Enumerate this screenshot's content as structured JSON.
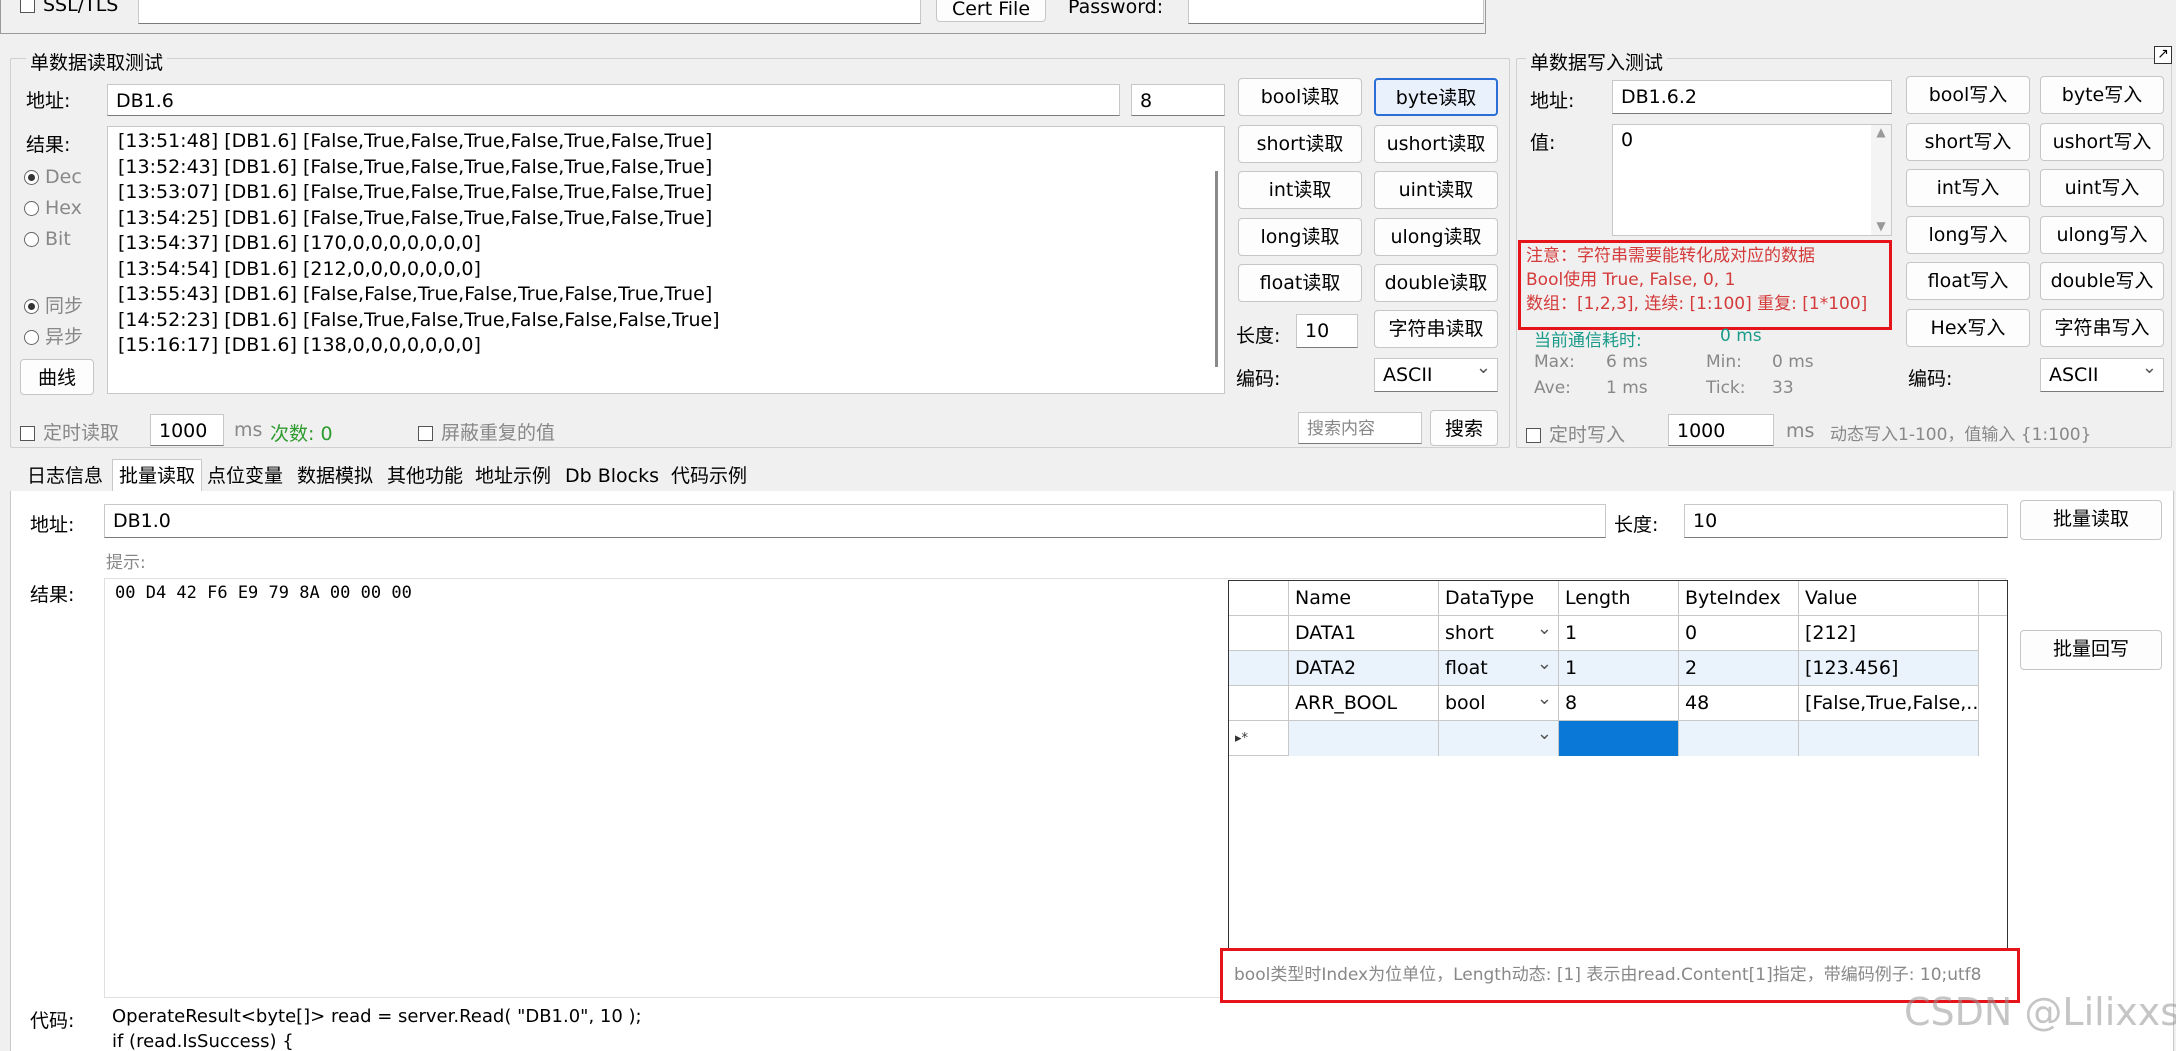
{
  "top": {
    "ssl_label": "SSL/TLS",
    "cert_button": "Cert File",
    "password_label": "Password:"
  },
  "read_panel": {
    "title": "单数据读取测试",
    "address_label": "地址:",
    "address_value": "DB1.6",
    "length_value": "8",
    "result_label": "结果:",
    "radios": {
      "dec": "Dec",
      "hex": "Hex",
      "bit": "Bit",
      "sync": "同步",
      "async": "异步"
    },
    "curve_button": "曲线",
    "log": [
      "[13:51:48] [DB1.6] [False,True,False,True,False,True,False,True]",
      "[13:52:43] [DB1.6] [False,True,False,True,False,True,False,True]",
      "[13:53:07] [DB1.6] [False,True,False,True,False,True,False,True]",
      "[13:54:25] [DB1.6] [False,True,False,True,False,True,False,True]",
      "[13:54:37] [DB1.6] [170,0,0,0,0,0,0,0]",
      "[13:54:54] [DB1.6] [212,0,0,0,0,0,0,0]",
      "[13:55:43] [DB1.6] [False,False,True,False,True,False,True,True]",
      "[14:52:23] [DB1.6] [False,True,False,True,False,False,False,True]",
      "[15:16:17] [DB1.6] [138,0,0,0,0,0,0,0]"
    ],
    "buttons": [
      "bool读取",
      "byte读取",
      "short读取",
      "ushort读取",
      "int读取",
      "uint读取",
      "long读取",
      "ulong读取",
      "float读取",
      "double读取"
    ],
    "length_label": "长度:",
    "length_field": "10",
    "string_read_button": "字符串读取",
    "encoding_label": "编码:",
    "encoding_value": "ASCII",
    "timer_label": "定时读取",
    "timer_value": "1000",
    "ms": "ms",
    "count_label": "次数: 0",
    "hide_dup_label": "屏蔽重复的值",
    "search_placeholder": "搜索内容",
    "search_button": "搜索"
  },
  "write_panel": {
    "title": "单数据写入测试",
    "address_label": "地址:",
    "address_value": "DB1.6.2",
    "value_label": "值:",
    "value_value": "0",
    "note_lines": [
      "注意：字符串需要能转化成对应的数据",
      "Bool使用 True, False, 0, 1",
      "数组：[1,2,3], 连续: [1:100] 重复: [1*100]"
    ],
    "stats_title": "当前通信耗时:",
    "stats_now": "0 ms",
    "max_label": "Max:",
    "max_value": "6 ms",
    "min_label": "Min:",
    "min_value": "0 ms",
    "ave_label": "Ave:",
    "ave_value": "1 ms",
    "tick_label": "Tick:",
    "tick_value": "33",
    "buttons": [
      "bool写入",
      "byte写入",
      "short写入",
      "ushort写入",
      "int写入",
      "uint写入",
      "long写入",
      "ulong写入",
      "float写入",
      "double写入",
      "Hex写入",
      "字符串写入"
    ],
    "encoding_label": "编码:",
    "encoding_value": "ASCII",
    "timer_label": "定时写入",
    "timer_value": "1000",
    "ms": "ms",
    "hint": "动态写入1-100，值输入 {1:100}",
    "corner_icon": "popout-icon"
  },
  "tabs": [
    "日志信息",
    "批量读取",
    "点位变量",
    "数据模拟",
    "其他功能",
    "地址示例",
    "Db Blocks",
    "代码示例"
  ],
  "active_tab": 1,
  "batch": {
    "address_label": "地址:",
    "address_value": "DB1.0",
    "length_label": "长度:",
    "length_value": "10",
    "read_button": "批量读取",
    "hint_label": "提示:",
    "result_label": "结果:",
    "result_value": "00 D4 42 F6 E9 79 8A 00 00 00",
    "writeback_button": "批量回写",
    "columns": [
      "Name",
      "DataType",
      "Length",
      "ByteIndex",
      "Value"
    ],
    "rows": [
      {
        "name": "DATA1",
        "type": "short",
        "length": "1",
        "index": "0",
        "value": "[212]"
      },
      {
        "name": "DATA2",
        "type": "float",
        "length": "1",
        "index": "2",
        "value": "[123.456]"
      },
      {
        "name": "ARR_BOOL",
        "type": "bool",
        "length": "8",
        "index": "48",
        "value": "[False,True,False,..."
      }
    ],
    "new_row_marker": "▸*",
    "note": "bool类型时Index为位单位，Length动态: [1] 表示由read.Content[1]指定，带编码例子: 10;utf8",
    "code_label": "代码:",
    "code_lines": [
      "OperateResult<byte[]> read = server.Read( \"DB1.0\", 10 );",
      "if (read.IsSuccess) {"
    ]
  },
  "watermark": "CSDN @Lilixxs",
  "colors": {
    "focus_blue": "#2b6fd6",
    "note_red": "#d43a3a",
    "highlight_red": "#e5141b",
    "green": "#2e9b2e",
    "teal": "#1a9b8a",
    "cell_select": "#0a78d7"
  }
}
